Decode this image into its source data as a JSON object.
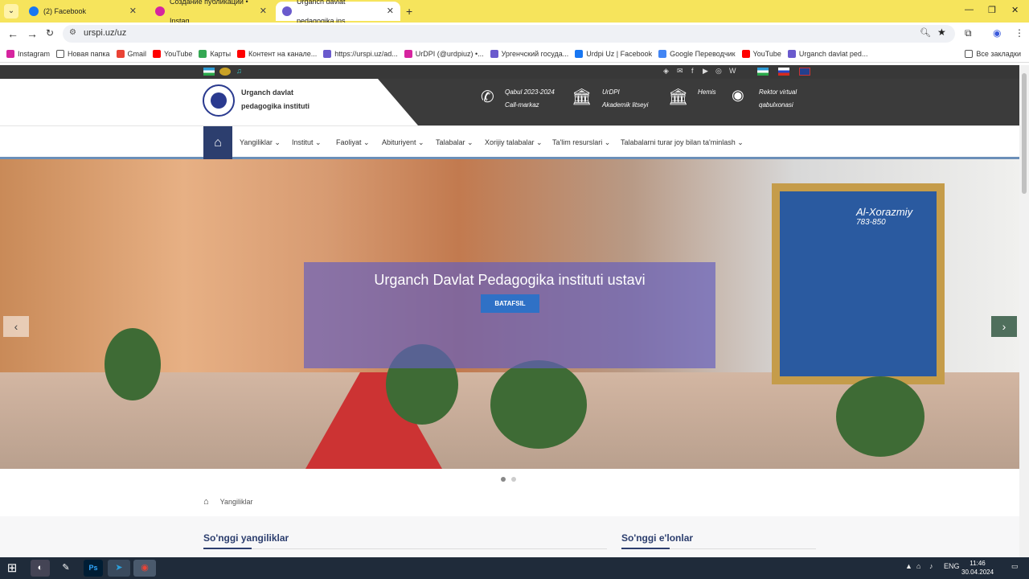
{
  "browser": {
    "tabs": [
      {
        "title": "(2) Facebook",
        "active": false
      },
      {
        "title": "Создание публикации • Instag",
        "active": false
      },
      {
        "title": "Urganch davlat pedagogika ins",
        "active": true
      }
    ],
    "url": "urspi.uz/uz",
    "bookmarks": [
      "Instagram",
      "Новая папка",
      "Gmail",
      "YouTube",
      "Карты",
      "Контент на канале...",
      "https://urspi.uz/ad...",
      "UrDPI (@urdpiuz) •...",
      "Ургенчский госуда...",
      "Urdpi Uz | Facebook",
      "Google Переводчик",
      "YouTube",
      "Urganch davlat ped..."
    ],
    "all_bookmarks": "Все закладки"
  },
  "site": {
    "institute_name_line1": "Urganch davlat",
    "institute_name_line2": "pedagogika instituti",
    "header_items": [
      {
        "line1": "Qabul 2023-2024",
        "line2": "Call-markaz",
        "icon": "phone-icon"
      },
      {
        "line1": "UrDPI",
        "line2": "Akademik litseyi",
        "icon": "building-icon"
      },
      {
        "line1": "Hemis",
        "line2": "",
        "icon": "building-icon"
      },
      {
        "line1": "Rektor virtual",
        "line2": "qabulxonasi",
        "icon": "telegram-icon"
      }
    ],
    "nav": [
      "Yangiliklar",
      "Institut",
      "Faoliyat",
      "Abituriyent",
      "Talabalar",
      "Xorijiy talabalar",
      "Ta'lim resurslari",
      "Talabalarni turar joy bilan ta'minlash"
    ],
    "slide_caption": "Urganch Davlat Pedagogika instituti ustavi",
    "slide_button": "BATAFSIL",
    "portrait_title": "Al-Xorazmiy",
    "portrait_years": "783-850",
    "breadcrumb": "Yangiliklar",
    "latest_news": "So'nggi yangiliklar",
    "latest_announcements": "So'nggi e'lonlar"
  },
  "taskbar": {
    "language": "ENG",
    "time": "11:46",
    "date": "30.04.2024"
  }
}
